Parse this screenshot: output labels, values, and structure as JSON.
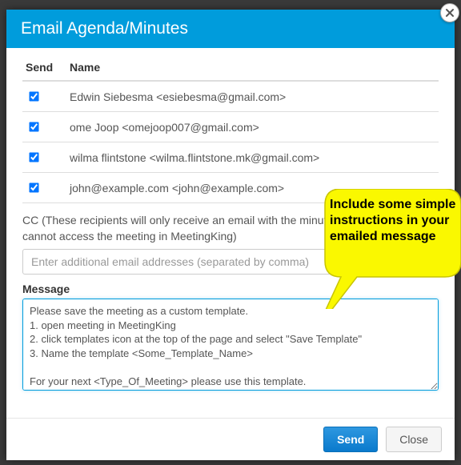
{
  "header": {
    "title": "Email Agenda/Minutes"
  },
  "columns": {
    "send": "Send",
    "name": "Name"
  },
  "recipients": [
    {
      "label": "Edwin Siebesma <esiebesma@gmail.com>"
    },
    {
      "label": "ome Joop <omejoop007@gmail.com>"
    },
    {
      "label": "wilma flintstone <wilma.flintstone.mk@gmail.com>"
    },
    {
      "label": "john@example.com <john@example.com>"
    }
  ],
  "cc": {
    "label": "CC (These recipients will only receive an email with the minutes/agenda, they cannot access the meeting in MeetingKing)",
    "placeholder": "Enter additional email addresses (separated by comma)"
  },
  "message": {
    "label": "Message",
    "value": "Please save the meeting as a custom template.\n1. open meeting in MeetingKing\n2. click templates icon at the top of the page and select \"Save Template\"\n3. Name the template <Some_Template_Name>\n\nFor your next <Type_Of_Meeting> please use this template."
  },
  "buttons": {
    "send": "Send",
    "close": "Close"
  },
  "callout": {
    "text": "Include some simple instructions in your emailed message"
  }
}
